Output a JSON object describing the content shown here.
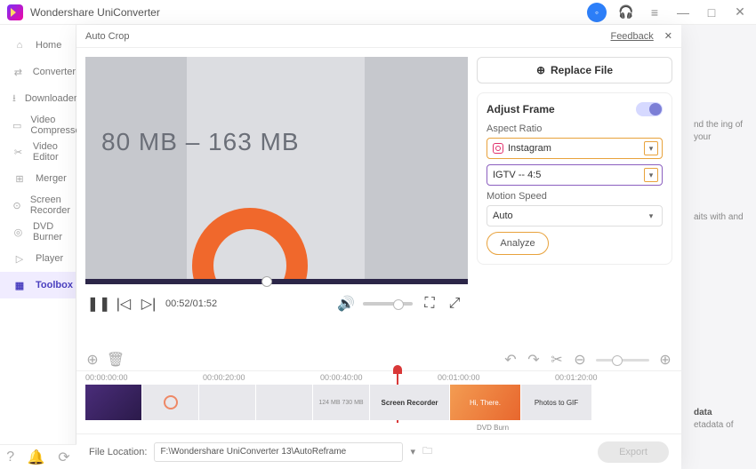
{
  "app": {
    "title": "Wondershare UniConverter"
  },
  "sidebar": {
    "items": [
      {
        "label": "Home",
        "icon": "home"
      },
      {
        "label": "Converter",
        "icon": "convert"
      },
      {
        "label": "Downloader",
        "icon": "download"
      },
      {
        "label": "Video Compressor",
        "icon": "compress"
      },
      {
        "label": "Video Editor",
        "icon": "cut"
      },
      {
        "label": "Merger",
        "icon": "merge"
      },
      {
        "label": "Screen Recorder",
        "icon": "record"
      },
      {
        "label": "DVD Burner",
        "icon": "dvd"
      },
      {
        "label": "Player",
        "icon": "play"
      },
      {
        "label": "Toolbox",
        "icon": "grid"
      }
    ]
  },
  "modal": {
    "title": "Auto Crop",
    "feedback": "Feedback",
    "replace": "Replace File",
    "adjust_frame": "Adjust Frame",
    "aspect_label": "Aspect Ratio",
    "aspect_preset": "Instagram",
    "aspect_value": "IGTV -- 4:5",
    "motion_label": "Motion Speed",
    "motion_value": "Auto",
    "analyze": "Analyze",
    "preview_text": "80 MB    –    163 MB",
    "time": "00:52/01:52"
  },
  "timeline": {
    "ticks": [
      "00:00:00:00",
      "00:00:20:00",
      "00:00:40:00",
      "00:01:00:00",
      "00:01:20:00"
    ],
    "thumbs": [
      "",
      "",
      "",
      "",
      "124 MB   730 MB",
      "Screen Recorder",
      "Hi, There.",
      "Photos to GIF"
    ],
    "extra_thumb": "DVD Burn"
  },
  "footer": {
    "loc_label": "File Location:",
    "loc_value": "F:\\Wondershare UniConverter 13\\AutoReframe",
    "export": "Export"
  },
  "bg": {
    "t1": "nd the ing of your",
    "t2": "aits with and",
    "t3": "data",
    "t4": "etadata of"
  }
}
